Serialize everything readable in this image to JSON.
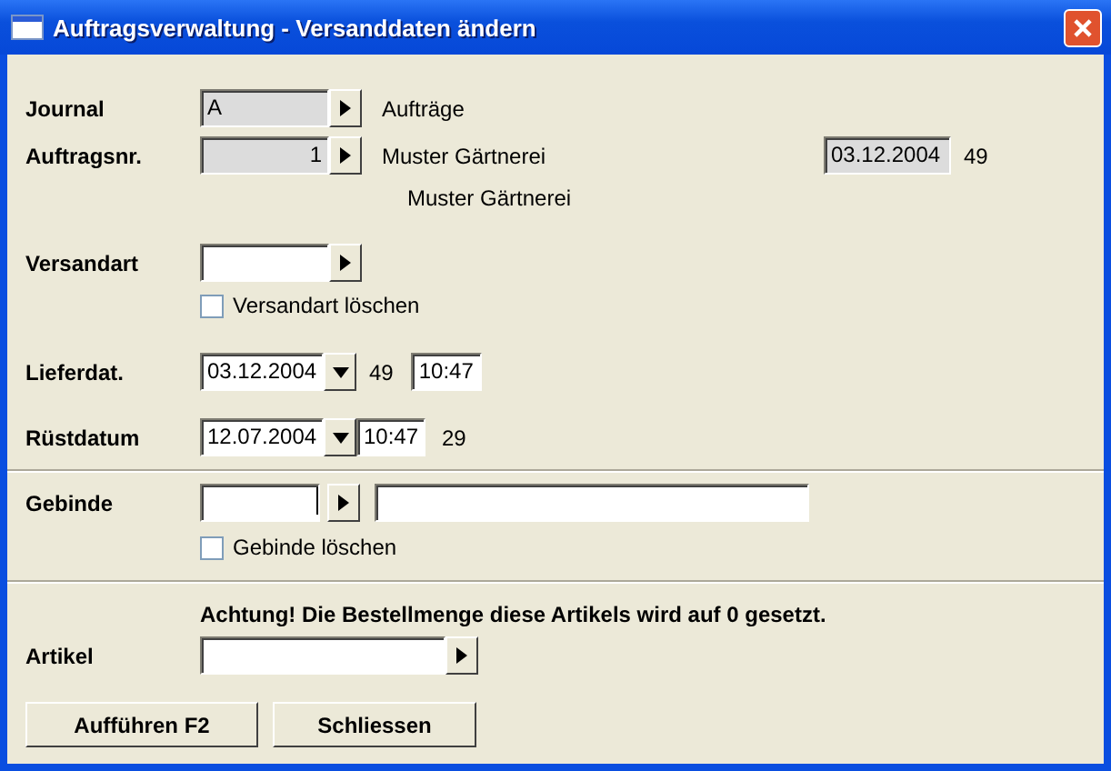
{
  "window": {
    "title": "Auftragsverwaltung - Versanddaten ändern"
  },
  "journal": {
    "label": "Journal",
    "value": "A",
    "disabled": true,
    "description": "Aufträge"
  },
  "order": {
    "label": "Auftragsnr.",
    "value": "1",
    "disabled": true,
    "customer": "Muster Gärtnerei",
    "customer_2": "Muster Gärtnerei",
    "date": "03.12.2004",
    "week": "49"
  },
  "shipping": {
    "label": "Versandart",
    "clear": {
      "label": "Versandart löschen",
      "checked": false
    }
  },
  "delivery": {
    "label": "Lieferdat.",
    "date": "03.12.2004",
    "week": "49",
    "time": "10:47"
  },
  "preparation": {
    "label": "Rüstdatum",
    "date": "12.07.2004",
    "time": "10:47",
    "week": "29"
  },
  "container": {
    "label": "Gebinde",
    "clear": {
      "label": "Gebinde löschen",
      "checked": false
    }
  },
  "warning": "Achtung! Die Bestellmenge diese Artikels wird auf 0 gesetzt.",
  "article": {
    "label": "Artikel"
  },
  "buttons": [
    "Aufführen F2",
    "Schliessen"
  ]
}
